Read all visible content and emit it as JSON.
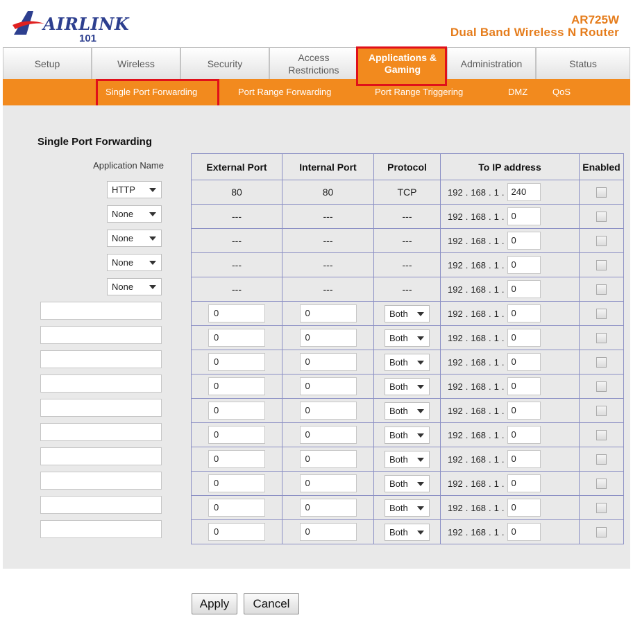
{
  "header": {
    "logo_text": "AIRLINK",
    "logo_sub": "101",
    "model": "AR725W",
    "product": "Dual Band Wireless N Router"
  },
  "tabs": [
    {
      "label": "Setup"
    },
    {
      "label": "Wireless"
    },
    {
      "label": "Security"
    },
    {
      "label": "Access\nRestrictions"
    },
    {
      "label": "Applications &\nGaming",
      "active": true
    },
    {
      "label": "Administration"
    },
    {
      "label": "Status"
    }
  ],
  "subnav": [
    {
      "label": "Single Port Forwarding",
      "active": true
    },
    {
      "label": "Port Range Forwarding"
    },
    {
      "label": "Port Range Triggering"
    },
    {
      "label": "DMZ"
    },
    {
      "label": "QoS"
    }
  ],
  "section": {
    "title": "Single Port Forwarding",
    "app_name_header": "Application Name"
  },
  "columns": {
    "external": "External Port",
    "internal": "Internal Port",
    "protocol": "Protocol",
    "ip": "To IP address",
    "enabled": "Enabled"
  },
  "ip_prefix": [
    "192",
    "168",
    "1"
  ],
  "preset_rows": [
    {
      "app": "HTTP",
      "external": "80",
      "internal": "80",
      "protocol": "TCP",
      "ip_last": "240",
      "enabled": false
    },
    {
      "app": "None",
      "external": "---",
      "internal": "---",
      "protocol": "---",
      "ip_last": "0",
      "enabled": false
    },
    {
      "app": "None",
      "external": "---",
      "internal": "---",
      "protocol": "---",
      "ip_last": "0",
      "enabled": false
    },
    {
      "app": "None",
      "external": "---",
      "internal": "---",
      "protocol": "---",
      "ip_last": "0",
      "enabled": false
    },
    {
      "app": "None",
      "external": "---",
      "internal": "---",
      "protocol": "---",
      "ip_last": "0",
      "enabled": false
    }
  ],
  "custom_rows": [
    {
      "app": "",
      "external": "0",
      "internal": "0",
      "protocol": "Both",
      "ip_last": "0",
      "enabled": false
    },
    {
      "app": "",
      "external": "0",
      "internal": "0",
      "protocol": "Both",
      "ip_last": "0",
      "enabled": false
    },
    {
      "app": "",
      "external": "0",
      "internal": "0",
      "protocol": "Both",
      "ip_last": "0",
      "enabled": false
    },
    {
      "app": "",
      "external": "0",
      "internal": "0",
      "protocol": "Both",
      "ip_last": "0",
      "enabled": false
    },
    {
      "app": "",
      "external": "0",
      "internal": "0",
      "protocol": "Both",
      "ip_last": "0",
      "enabled": false
    },
    {
      "app": "",
      "external": "0",
      "internal": "0",
      "protocol": "Both",
      "ip_last": "0",
      "enabled": false
    },
    {
      "app": "",
      "external": "0",
      "internal": "0",
      "protocol": "Both",
      "ip_last": "0",
      "enabled": false
    },
    {
      "app": "",
      "external": "0",
      "internal": "0",
      "protocol": "Both",
      "ip_last": "0",
      "enabled": false
    },
    {
      "app": "",
      "external": "0",
      "internal": "0",
      "protocol": "Both",
      "ip_last": "0",
      "enabled": false
    },
    {
      "app": "",
      "external": "0",
      "internal": "0",
      "protocol": "Both",
      "ip_last": "0",
      "enabled": false
    }
  ],
  "buttons": {
    "apply": "Apply",
    "cancel": "Cancel"
  },
  "colors": {
    "accent": "#f28a1e",
    "highlight": "#e0101a",
    "brand": "#2d3f8f"
  }
}
